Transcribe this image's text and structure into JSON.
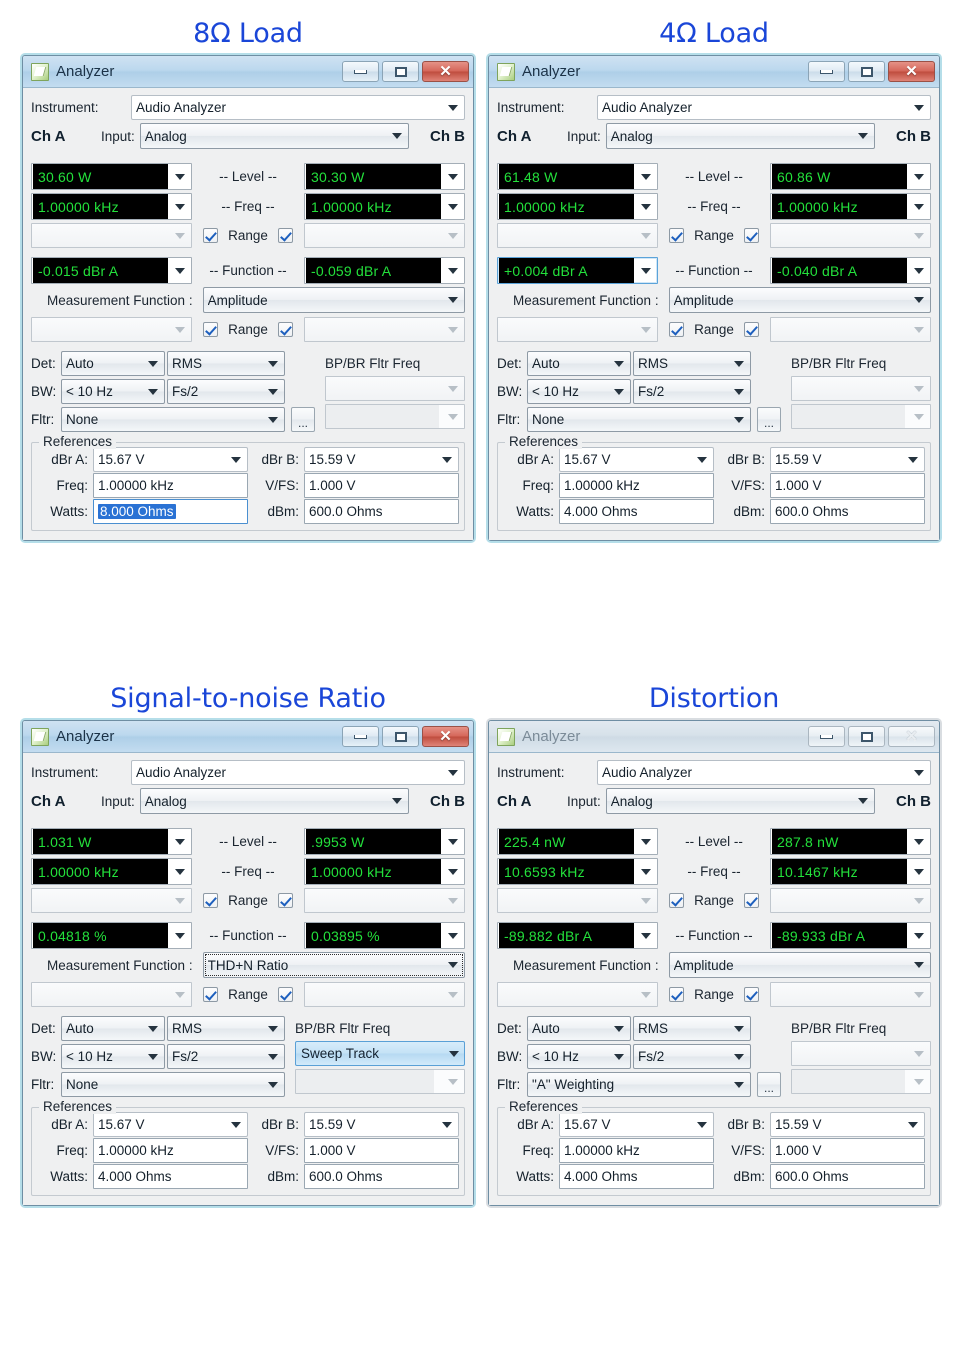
{
  "panels": [
    {
      "heading": "8Ω Load",
      "window_title": "Analyzer",
      "active": true,
      "instrument_label": "Instrument:",
      "instrument_value": "Audio Analyzer",
      "ch_a_label": "Ch A",
      "ch_b_label": "Ch B",
      "input_label": "Input:",
      "input_value": "Analog",
      "level_label": "-- Level --",
      "level_a": "30.60   W",
      "level_b": "30.30   W",
      "freq_label": "-- Freq --",
      "freq_a": "1.00000 kHz",
      "freq_b": "1.00000 kHz",
      "range_label": "Range",
      "function_label": "-- Function --",
      "function_a": "-0.015   dBr A",
      "function_b": "-0.059   dBr A",
      "function_a_focused": false,
      "measurement_function_label": "Measurement Function :",
      "measurement_function_value": "Amplitude",
      "measurement_function_focus_dotted": false,
      "det_label": "Det:",
      "det_value": "Auto",
      "det_value2": "RMS",
      "bw_label": "BW:",
      "bw_value": "< 10 Hz",
      "bw_value2": "Fs/2",
      "fltr_label": "Fltr:",
      "fltr_value": "None",
      "fltr_has_dots": true,
      "dots_label": "...",
      "bpbr_title": "BP/BR Fltr Freq",
      "bpbr_value": "",
      "bpbr_highlighted": false,
      "references_legend": "References",
      "dbra_label": "dBr A:",
      "dbra_value": "15.67    V",
      "dbrb_label": "dBr B:",
      "dbrb_value": "15.59    V",
      "freq_ref_label": "Freq:",
      "freq_ref_value": "1.00000 kHz",
      "vfs_label": "V/FS:",
      "vfs_value": "1.000    V",
      "watts_label": "Watts:",
      "watts_value": "8.000    Ohms",
      "watts_selected": true,
      "dbm_label": "dBm:",
      "dbm_value": "600.0    Ohms"
    },
    {
      "heading": "4Ω Load",
      "window_title": "Analyzer",
      "active": true,
      "instrument_label": "Instrument:",
      "instrument_value": "Audio Analyzer",
      "ch_a_label": "Ch A",
      "ch_b_label": "Ch B",
      "input_label": "Input:",
      "input_value": "Analog",
      "level_label": "-- Level --",
      "level_a": "61.48   W",
      "level_b": "60.86   W",
      "freq_label": "-- Freq --",
      "freq_a": "1.00000 kHz",
      "freq_b": "1.00000 kHz",
      "range_label": "Range",
      "function_label": "-- Function --",
      "function_a": "+0.004   dBr A",
      "function_b": "-0.040   dBr A",
      "function_a_focused": true,
      "measurement_function_label": "Measurement Function :",
      "measurement_function_value": "Amplitude",
      "measurement_function_focus_dotted": false,
      "det_label": "Det:",
      "det_value": "Auto",
      "det_value2": "RMS",
      "bw_label": "BW:",
      "bw_value": "< 10 Hz",
      "bw_value2": "Fs/2",
      "fltr_label": "Fltr:",
      "fltr_value": "None",
      "fltr_has_dots": true,
      "dots_label": "...",
      "bpbr_title": "BP/BR Fltr Freq",
      "bpbr_value": "",
      "bpbr_highlighted": false,
      "references_legend": "References",
      "dbra_label": "dBr A:",
      "dbra_value": "15.67    V",
      "dbrb_label": "dBr B:",
      "dbrb_value": "15.59    V",
      "freq_ref_label": "Freq:",
      "freq_ref_value": "1.00000 kHz",
      "vfs_label": "V/FS:",
      "vfs_value": "1.000    V",
      "watts_label": "Watts:",
      "watts_value": "4.000    Ohms",
      "watts_selected": false,
      "dbm_label": "dBm:",
      "dbm_value": "600.0    Ohms"
    },
    {
      "heading": "Signal-to-noise Ratio",
      "window_title": "Analyzer",
      "active": true,
      "instrument_label": "Instrument:",
      "instrument_value": "Audio Analyzer",
      "ch_a_label": "Ch A",
      "ch_b_label": "Ch B",
      "input_label": "Input:",
      "input_value": "Analog",
      "level_label": "-- Level --",
      "level_a": "1.031   W",
      "level_b": ".9953   W",
      "freq_label": "-- Freq --",
      "freq_a": "1.00000 kHz",
      "freq_b": "1.00000 kHz",
      "range_label": "Range",
      "function_label": "-- Function --",
      "function_a": "0.04818 %",
      "function_b": "0.03895 %",
      "function_a_focused": false,
      "measurement_function_label": "Measurement Function :",
      "measurement_function_value": "THD+N Ratio",
      "measurement_function_focus_dotted": true,
      "det_label": "Det:",
      "det_value": "Auto",
      "det_value2": "RMS",
      "bw_label": "BW:",
      "bw_value": "< 10 Hz",
      "bw_value2": "Fs/2",
      "fltr_label": "Fltr:",
      "fltr_value": "None",
      "fltr_has_dots": false,
      "dots_label": "...",
      "bpbr_title": "BP/BR Fltr Freq",
      "bpbr_value": "Sweep Track",
      "bpbr_highlighted": true,
      "references_legend": "References",
      "dbra_label": "dBr A:",
      "dbra_value": "15.67    V",
      "dbrb_label": "dBr B:",
      "dbrb_value": "15.59    V",
      "freq_ref_label": "Freq:",
      "freq_ref_value": "1.00000 kHz",
      "vfs_label": "V/FS:",
      "vfs_value": "1.000    V",
      "watts_label": "Watts:",
      "watts_value": "4.000    Ohms",
      "watts_selected": false,
      "dbm_label": "dBm:",
      "dbm_value": "600.0    Ohms"
    },
    {
      "heading": "Distortion",
      "window_title": "Analyzer",
      "active": false,
      "instrument_label": "Instrument:",
      "instrument_value": "Audio Analyzer",
      "ch_a_label": "Ch A",
      "ch_b_label": "Ch B",
      "input_label": "Input:",
      "input_value": "Analog",
      "level_label": "-- Level --",
      "level_a": "225.4   nW",
      "level_b": "287.8   nW",
      "freq_label": "-- Freq --",
      "freq_a": "10.6593 kHz",
      "freq_b": "10.1467 kHz",
      "range_label": "Range",
      "function_label": "-- Function --",
      "function_a": "-89.882 dBr A",
      "function_b": "-89.933 dBr A",
      "function_a_focused": false,
      "measurement_function_label": "Measurement Function :",
      "measurement_function_value": "Amplitude",
      "measurement_function_focus_dotted": false,
      "det_label": "Det:",
      "det_value": "Auto",
      "det_value2": "RMS",
      "bw_label": "BW:",
      "bw_value": "< 10 Hz",
      "bw_value2": "Fs/2",
      "fltr_label": "Fltr:",
      "fltr_value": "\"A\" Weighting",
      "fltr_has_dots": true,
      "dots_label": "...",
      "bpbr_title": "BP/BR Fltr Freq",
      "bpbr_value": "",
      "bpbr_highlighted": false,
      "references_legend": "References",
      "dbra_label": "dBr A:",
      "dbra_value": "15.67    V",
      "dbrb_label": "dBr B:",
      "dbrb_value": "15.59    V",
      "freq_ref_label": "Freq:",
      "freq_ref_value": "1.00000 kHz",
      "vfs_label": "V/FS:",
      "vfs_value": "1.000    V",
      "watts_label": "Watts:",
      "watts_value": "4.000    Ohms",
      "watts_selected": false,
      "dbm_label": "dBm:",
      "dbm_value": "600.0    Ohms"
    }
  ],
  "colors": {
    "heading": "#1a46d8",
    "led_text": "#23e03b",
    "led_bg": "#000000",
    "selection": "#2a72d4",
    "titlebar_active": "#bcd8ee",
    "close_red": "#c6503f"
  }
}
